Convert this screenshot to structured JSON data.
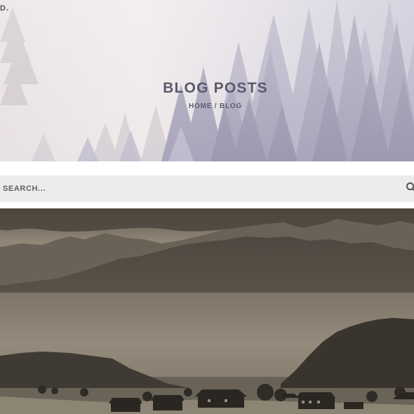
{
  "brand": {
    "fragment": "D."
  },
  "hero": {
    "title": "BLOG POSTS",
    "breadcrumb": {
      "home_label": "HOME",
      "separator": " / ",
      "current_label": "BLOG"
    }
  },
  "search": {
    "placeholder": "SEARCH...",
    "value": "",
    "icon": "search-icon"
  },
  "post": {
    "image": "misty-mountain-valley-photo"
  },
  "colors": {
    "title": "#5b5a6c",
    "search_bg": "#ececec",
    "sepia_light": "#b5ab9c",
    "sepia_dark": "#3b362f"
  }
}
